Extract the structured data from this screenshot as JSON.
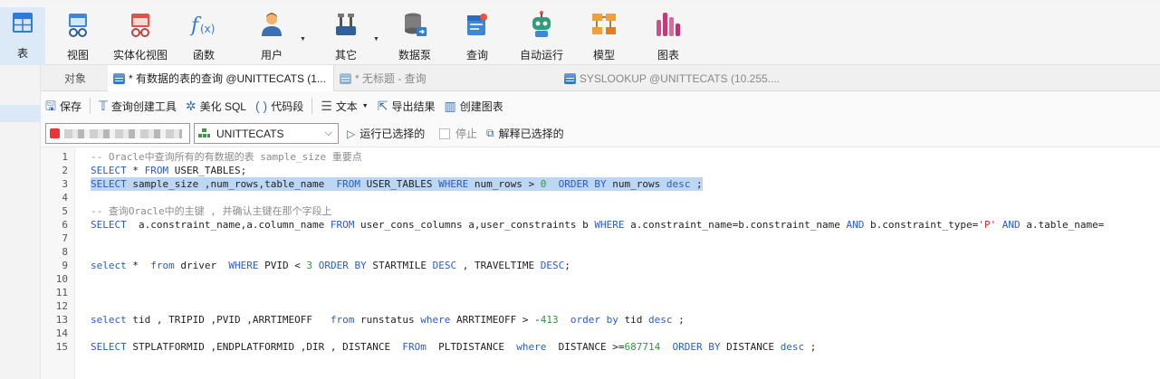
{
  "ribbon": {
    "buttons": [
      {
        "label": "表",
        "icon": "table-icon",
        "active": true
      },
      {
        "label": "视图",
        "icon": "view-icon"
      },
      {
        "label": "实体化视图",
        "icon": "materialized-view-icon"
      },
      {
        "label": "函数",
        "icon": "function-icon"
      },
      {
        "label": "用户",
        "icon": "user-icon",
        "dropdown": true
      },
      {
        "label": "其它",
        "icon": "tools-icon",
        "dropdown": true
      },
      {
        "label": "数据泵",
        "icon": "data-pump-icon"
      },
      {
        "label": "查询",
        "icon": "query-icon"
      },
      {
        "label": "自动运行",
        "icon": "robot-icon"
      },
      {
        "label": "模型",
        "icon": "model-icon"
      },
      {
        "label": "图表",
        "icon": "chart-icon"
      }
    ]
  },
  "tabs": [
    {
      "label": "对象"
    },
    {
      "label": "* 有数据的表的查询 @UNITTECATS (1..."
    },
    {
      "label": "* 无标题 - 查询"
    },
    {
      "label": "SYSLOOKUP @UNITTECATS (10.255...."
    }
  ],
  "toolbar": {
    "save": "保存",
    "query_builder": "查询创建工具",
    "beautify": "美化 SQL",
    "code_snippet": "代码段",
    "text": "文本",
    "export": "导出结果",
    "create_chart": "创建图表"
  },
  "connection": {
    "schema": "UNITTECATS",
    "run_selected": "运行已选择的",
    "stop": "停止",
    "explain_selected": "解释已选择的"
  },
  "editor": {
    "line_numbers": [
      "1",
      "2",
      "3",
      "4",
      "5",
      "6",
      "7",
      "8",
      "9",
      "10",
      "11",
      "12",
      "13",
      "14",
      "15"
    ],
    "lines": [
      "-- Oracle中查询所有的有数据的表 sample_size 重要点",
      "SELECT * FROM USER_TABLES;",
      "SELECT sample_size ,num_rows,table_name  FROM USER_TABLES WHERE num_rows > 0  ORDER BY num_rows desc ;",
      "",
      "-- 查询Oracle中的主键 , 并确认主键在那个字段上",
      "SELECT  a.constraint_name,a.column_name FROM user_cons_columns a,user_constraints b WHERE a.constraint_name=b.constraint_name AND b.constraint_type='P' AND a.table_name=",
      "",
      "",
      "select *  from driver  WHERE PVID < 3 ORDER BY STARTMILE DESC , TRAVELTIME DESC;",
      "",
      "",
      "",
      "select tid , TRIPID ,PVID ,ARRTIMEOFF   from runstatus where ARRTIMEOFF > -413  order by tid desc ;",
      "",
      "SELECT STPLATFORMID ,ENDPLATFORMID ,DIR , DISTANCE  FROm  PLTDISTANCE  where  DISTANCE >=687714  ORDER BY DISTANCE desc ;"
    ]
  },
  "colors": {
    "keyword": "#2b5cc7",
    "comment": "#8b8b8b",
    "number": "#2e9a39",
    "string": "#cc3333",
    "selection": "#bcd6f3"
  }
}
